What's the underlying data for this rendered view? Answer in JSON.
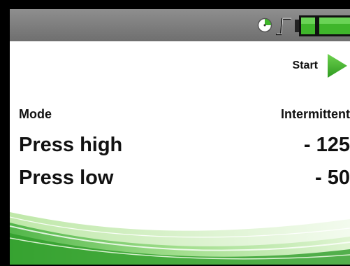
{
  "status": {
    "icons": [
      "clock-icon",
      "pulse-icon",
      "battery-icon"
    ],
    "battery_level": 1.0
  },
  "controls": {
    "start_label": "Start",
    "start_icon": "play-arrow-icon"
  },
  "settings": {
    "mode_label": "Mode",
    "mode_value": "Intermittent",
    "press_high_label": "Press high",
    "press_high_value": "- 125",
    "press_low_label": "Press low",
    "press_low_value": "- 50"
  },
  "colors": {
    "accent_green": "#3fb52b",
    "statusbar_gray": "#7d7d7d"
  }
}
